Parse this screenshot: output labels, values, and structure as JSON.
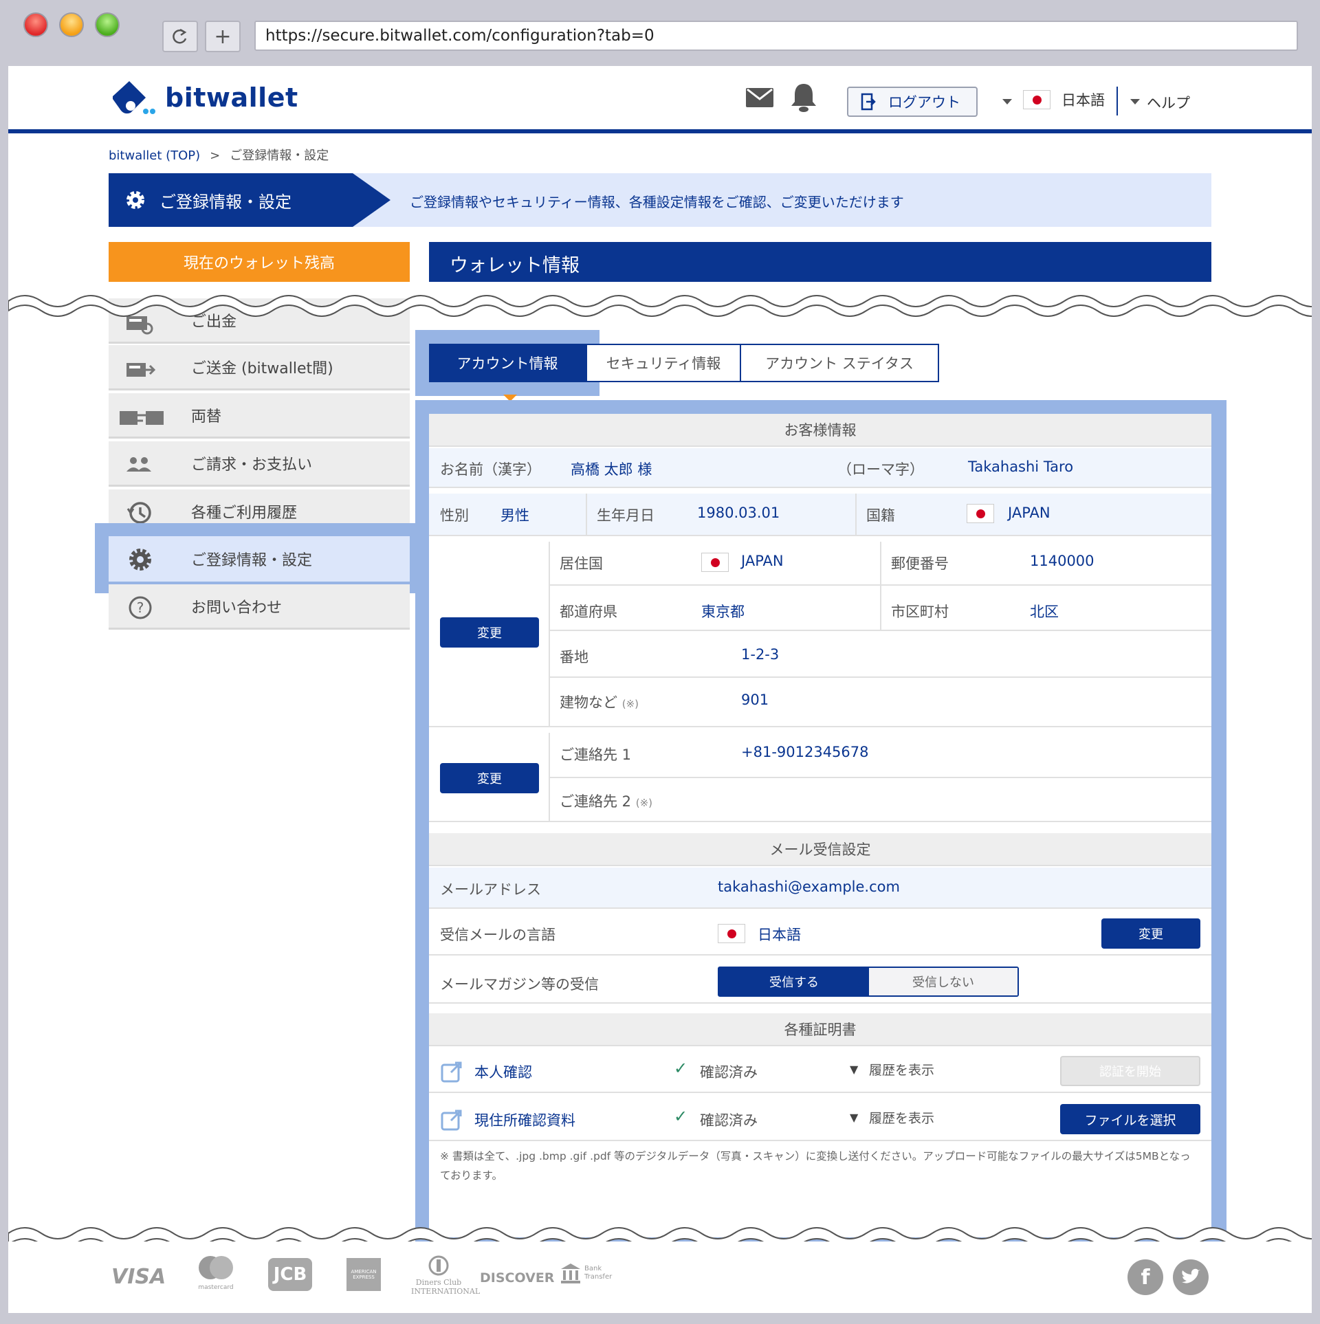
{
  "browser": {
    "url": "https://secure.bitwallet.com/configuration?tab=0",
    "reload_icon": "reload-icon",
    "newtab_symbol": "+"
  },
  "header": {
    "logo_text": "bitwallet",
    "logout_label": "ログアウト",
    "language": "日本語",
    "help": "ヘルプ"
  },
  "breadcrumb": {
    "top": "bitwallet (TOP)",
    "separator": ">",
    "current": "ご登録情報・設定"
  },
  "banner": {
    "title": "ご登録情報・設定",
    "description": "ご登録情報やセキュリティー情報、各種設定情報をご確認、ご変更いただけます"
  },
  "sidebar": {
    "balance": "現在のウォレット残高",
    "items": [
      {
        "label": "ご出金",
        "icon": "withdraw-icon"
      },
      {
        "label": "ご送金 (bitwallet間)",
        "icon": "transfer-icon"
      },
      {
        "label": "両替",
        "icon": "exchange-icon"
      },
      {
        "label": "ご請求・お支払い",
        "icon": "users-icon"
      },
      {
        "label": "各種ご利用履歴",
        "icon": "history-icon"
      },
      {
        "label": "ご登録情報・設定",
        "icon": "gear-icon"
      },
      {
        "label": "お問い合わせ",
        "icon": "question-icon"
      }
    ]
  },
  "wallet_title": "ウォレット情報",
  "tabs": [
    "アカウント情報",
    "セキュリティ情報",
    "アカウント ステイタス"
  ],
  "customer": {
    "section": "お客様情報",
    "name_kanji_label": "お名前（漢字）",
    "name_kanji": "高橋 太郎 様",
    "name_roman_label": "（ローマ字）",
    "name_roman": "Takahashi Taro",
    "gender_label": "性別",
    "gender": "男性",
    "birth_label": "生年月日",
    "birth": "1980.03.01",
    "nationality_label": "国籍",
    "nationality": "JAPAN",
    "residence_label": "居住国",
    "residence": "JAPAN",
    "postal_label": "郵便番号",
    "postal": "1140000",
    "prefecture_label": "都道府県",
    "prefecture": "東京都",
    "city_label": "市区町村",
    "city": "北区",
    "address_label": "番地",
    "address": "1-2-3",
    "building_label": "建物など",
    "optional_mark": "(※)",
    "building": "901",
    "contact1_label": "ご連絡先 1",
    "contact1": "+81-9012345678",
    "contact2_label": "ご連絡先 2",
    "change": "変更"
  },
  "mail": {
    "section": "メール受信設定",
    "address_label": "メールアドレス",
    "address": "takahashi@example.com",
    "lang_label": "受信メールの言語",
    "lang": "日本語",
    "change": "変更",
    "magazine_label": "メールマガジン等の受信",
    "receive": "受信する",
    "not_receive": "受信しない"
  },
  "certs": {
    "section": "各種証明書",
    "items": [
      {
        "name": "本人確認",
        "status": "確認済み",
        "history": "履歴を表示",
        "action": "認証を開始"
      },
      {
        "name": "現住所確認資料",
        "status": "確認済み",
        "history": "履歴を表示",
        "action": "ファイルを選択"
      }
    ],
    "note": "※ 書類は全て、.jpg .bmp .gif .pdf 等のデジタルデータ（写真・スキャン）に変換し送付ください。アップロード可能なファイルの最大サイズは5MBとなっております。"
  },
  "footer": {
    "payments": [
      "VISA",
      "mastercard",
      "JCB",
      "AMERICAN EXPRESS",
      "Diners Club INTERNATIONAL",
      "DISCOVER",
      "Bank Transfer"
    ],
    "social": [
      "facebook-icon",
      "twitter-icon"
    ]
  },
  "colors": {
    "brand": "#0a3590",
    "accent": "#f7941d",
    "highlight": "#97b4e4",
    "panel_blue": "#dfe8fb"
  }
}
